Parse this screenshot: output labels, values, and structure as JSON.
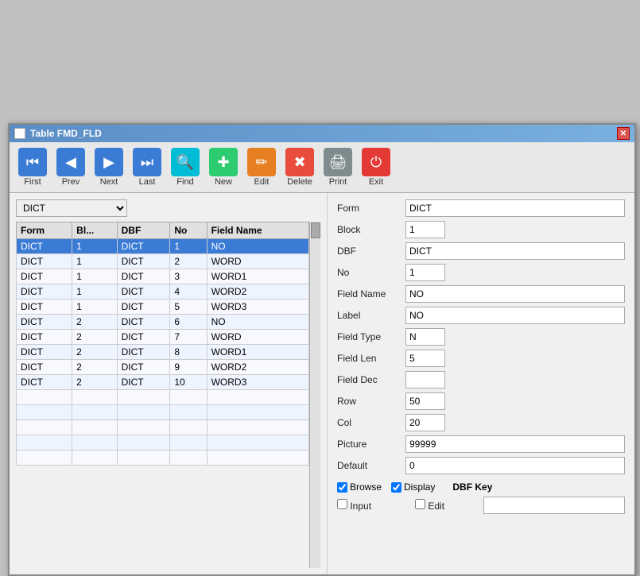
{
  "window": {
    "title": "Table FMD_FLD",
    "close_label": "✕"
  },
  "toolbar": {
    "buttons": [
      {
        "id": "first",
        "label": "First",
        "icon": "⏮",
        "color": "btn-blue"
      },
      {
        "id": "prev",
        "label": "Prev",
        "icon": "◀",
        "color": "btn-blue"
      },
      {
        "id": "next",
        "label": "Next",
        "icon": "▶",
        "color": "btn-blue"
      },
      {
        "id": "last",
        "label": "Last",
        "icon": "⏭",
        "color": "btn-blue"
      },
      {
        "id": "find",
        "label": "Find",
        "icon": "🔍",
        "color": "btn-cyan"
      },
      {
        "id": "new",
        "label": "New",
        "icon": "✚",
        "color": "btn-teal"
      },
      {
        "id": "edit",
        "label": "Edit",
        "icon": "✎",
        "color": "btn-orange"
      },
      {
        "id": "delete",
        "label": "Delete",
        "icon": "✖",
        "color": "btn-red"
      },
      {
        "id": "print",
        "label": "Print",
        "icon": "🖨",
        "color": "btn-gray"
      },
      {
        "id": "exit",
        "label": "Exit",
        "icon": "⏻",
        "color": "btn-dark"
      }
    ]
  },
  "dropdown": {
    "options": [
      "DICT"
    ],
    "selected": "DICT"
  },
  "table": {
    "columns": [
      "Form",
      "Bl...",
      "DBF",
      "No",
      "Field Name"
    ],
    "rows": [
      {
        "form": "DICT",
        "block": "1",
        "dbf": "DICT",
        "no": "1",
        "fieldname": "NO",
        "selected": true
      },
      {
        "form": "DICT",
        "block": "1",
        "dbf": "DICT",
        "no": "2",
        "fieldname": "WORD",
        "selected": false
      },
      {
        "form": "DICT",
        "block": "1",
        "dbf": "DICT",
        "no": "3",
        "fieldname": "WORD1",
        "selected": false
      },
      {
        "form": "DICT",
        "block": "1",
        "dbf": "DICT",
        "no": "4",
        "fieldname": "WORD2",
        "selected": false
      },
      {
        "form": "DICT",
        "block": "1",
        "dbf": "DICT",
        "no": "5",
        "fieldname": "WORD3",
        "selected": false
      },
      {
        "form": "DICT",
        "block": "2",
        "dbf": "DICT",
        "no": "6",
        "fieldname": "NO",
        "selected": false
      },
      {
        "form": "DICT",
        "block": "2",
        "dbf": "DICT",
        "no": "7",
        "fieldname": "WORD",
        "selected": false
      },
      {
        "form": "DICT",
        "block": "2",
        "dbf": "DICT",
        "no": "8",
        "fieldname": "WORD1",
        "selected": false
      },
      {
        "form": "DICT",
        "block": "2",
        "dbf": "DICT",
        "no": "9",
        "fieldname": "WORD2",
        "selected": false
      },
      {
        "form": "DICT",
        "block": "2",
        "dbf": "DICT",
        "no": "10",
        "fieldname": "WORD3",
        "selected": false
      }
    ]
  },
  "detail": {
    "form_label": "Form",
    "form_value": "DICT",
    "block_label": "Block",
    "block_value": "1",
    "dbf_label": "DBF",
    "dbf_value": "DICT",
    "no_label": "No",
    "no_value": "1",
    "fieldname_label": "Field Name",
    "fieldname_value": "NO",
    "label_label": "Label",
    "label_value": "NO",
    "fieldtype_label": "Field Type",
    "fieldtype_value": "N",
    "fieldlen_label": "Field Len",
    "fieldlen_value": "5",
    "fielddec_label": "Field Dec",
    "fielddec_value": "",
    "row_label": "Row",
    "row_value": "50",
    "col_label": "Col",
    "col_value": "20",
    "picture_label": "Picture",
    "picture_value": "99999",
    "default_label": "Default",
    "default_value": "0",
    "browse_label": "Browse",
    "display_label": "Display",
    "input_label": "Input",
    "edit_label": "Edit",
    "dbf_key_label": "DBF Key",
    "dbf_key_value": ""
  }
}
